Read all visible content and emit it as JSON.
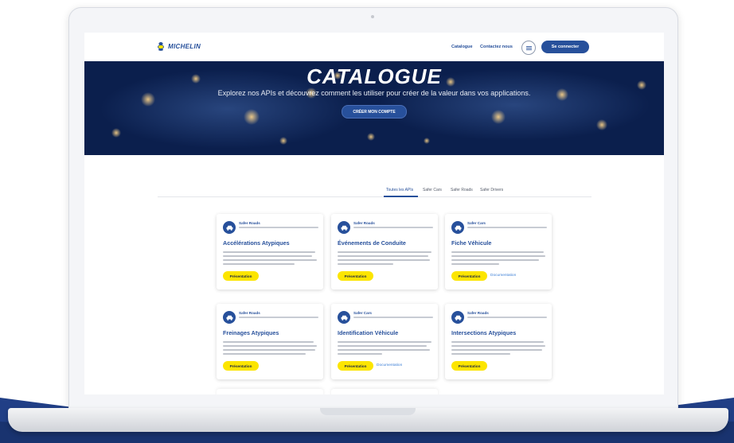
{
  "header": {
    "brand": "MICHELIN",
    "nav": [
      "Catalogue",
      "Contactez nous"
    ],
    "login_label": "Se connecter"
  },
  "hero": {
    "title": "CATALOGUE",
    "subtitle": "Explorez nos APIs et découvrez comment les utiliser pour créer de la valeur dans vos applications.",
    "cta_label": "CRÉER MON COMPTE"
  },
  "tabs": [
    {
      "label": "Toutes les APIs",
      "active": true
    },
    {
      "label": "Safer Cars",
      "active": false
    },
    {
      "label": "Safer Roads",
      "active": false
    },
    {
      "label": "Safer Drivers",
      "active": false
    }
  ],
  "cards": [
    {
      "category": "Safer Roads",
      "title": "Accélérations Atypiques",
      "primary_label": "Présentation",
      "doc_label": ""
    },
    {
      "category": "Safer Roads",
      "title": "Événements de Conduite",
      "primary_label": "Présentation",
      "doc_label": ""
    },
    {
      "category": "Safer Cars",
      "title": "Fiche Véhicule",
      "primary_label": "Présentation",
      "doc_label": "Documentation"
    },
    {
      "category": "Safer Roads",
      "title": "Freinages Atypiques",
      "primary_label": "Présentation",
      "doc_label": ""
    },
    {
      "category": "Safer Cars",
      "title": "Identification Véhicule",
      "primary_label": "Présentation",
      "doc_label": "Documentation"
    },
    {
      "category": "Safer Roads",
      "title": "Intersections Atypiques",
      "primary_label": "Présentation",
      "doc_label": ""
    }
  ],
  "colors": {
    "brand_blue": "#27509b",
    "hero_navy": "#0b1f4d",
    "button_yellow": "#fce500",
    "swoosh_blue": "#213f86"
  },
  "icons": {
    "card_icon": "car-icon",
    "menu": "menu-icon",
    "logo": "michelin-man-icon"
  }
}
